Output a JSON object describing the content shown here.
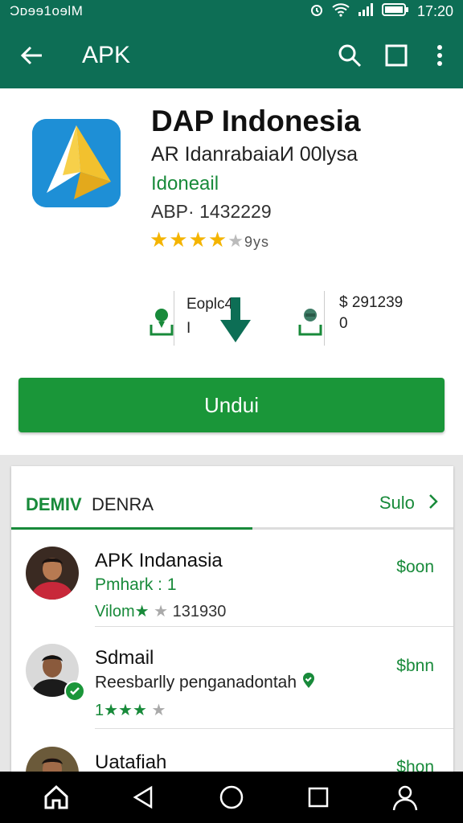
{
  "status_bar": {
    "left_text": "Ͻᴅɘɘ1ᴏɘlM",
    "time": "17:20"
  },
  "app_bar": {
    "title": "APK"
  },
  "app": {
    "name": "DAP Indonesia",
    "developer": "AR IdanrabaiaИ 00lysa",
    "category": "Idoneail",
    "id": "ABP· 1432229",
    "stars_filled": "★★★★",
    "stars_empty": "★",
    "rating_count": "9ys"
  },
  "stats": {
    "left_top": "Eoplc4",
    "left_bottom": "I",
    "right_top": "$ 291239",
    "right_bottom": "0"
  },
  "install_button": {
    "label": "Undui"
  },
  "section": {
    "tab_active": "DEMIV",
    "tab_other": "DENRA",
    "see_more": "Sulo"
  },
  "list": [
    {
      "title": "APK Indanasia",
      "subtitle": "Pmhark :  1",
      "rating_prefix": "Vilom",
      "stars_filled": "★",
      "stars_empty": "★",
      "count": "131930",
      "price": "$oon"
    },
    {
      "title": "Sdmail",
      "subtitle": "Reesbarlly penganadontah",
      "rating_prefix": "1",
      "stars_filled": "1★★★",
      "stars_empty": "★",
      "count": "",
      "price": "$bnn"
    },
    {
      "title": "Uatafiah",
      "price": "$hon"
    }
  ],
  "colors": {
    "primary": "#0d6e55",
    "accent_green": "#1a9639",
    "star": "#f4b400"
  }
}
